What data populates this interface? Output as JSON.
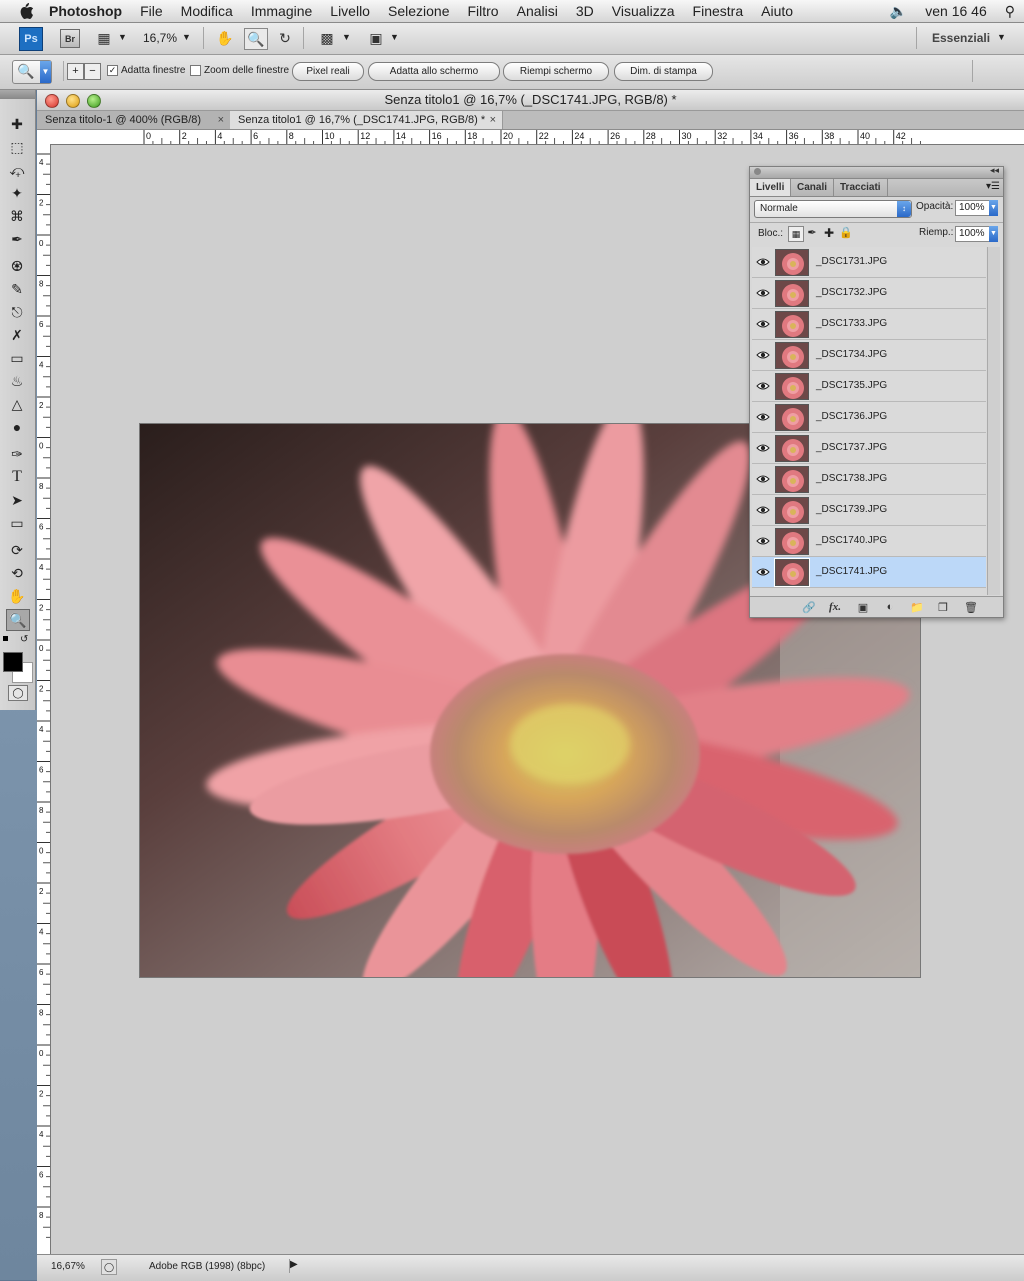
{
  "menubar": {
    "app_name": "Photoshop",
    "items": [
      "File",
      "Modifica",
      "Immagine",
      "Livello",
      "Selezione",
      "Filtro",
      "Analisi",
      "3D",
      "Visualizza",
      "Finestra",
      "Aiuto"
    ],
    "clock": "ven 16 46"
  },
  "appbar": {
    "ps_label": "Ps",
    "br_label": "Br",
    "zoom_value": "16,7%",
    "workspace": "Essenziali"
  },
  "options": {
    "adatta_finestre": "Adatta finestre",
    "adatta_finestre_checked": true,
    "zoom_finestre": "Zoom delle finestre",
    "zoom_finestre_checked": false,
    "btn_pixel_reali": "Pixel reali",
    "btn_adatta_schermo": "Adatta allo schermo",
    "btn_riempi_schermo": "Riempi schermo",
    "btn_dim_stampa": "Dim. di stampa"
  },
  "document": {
    "title": "Senza titolo1 @ 16,7% (_DSC1741.JPG, RGB/8) *",
    "tabs": [
      {
        "label": "Senza titolo-1 @ 400% (RGB/8)",
        "close": "×"
      },
      {
        "label": "Senza titolo1 @ 16,7% (_DSC1741.JPG, RGB/8) *",
        "close": "×"
      }
    ],
    "ruler_h": [
      "0",
      "2",
      "4",
      "6",
      "8",
      "10",
      "12",
      "14",
      "16",
      "18",
      "20",
      "22",
      "24",
      "26",
      "28",
      "30",
      "32",
      "34",
      "36",
      "38",
      "40",
      "42"
    ],
    "ruler_v": [
      "4",
      "2",
      "0",
      "8",
      "6",
      "4",
      "2",
      "0",
      "8",
      "6",
      "4",
      "2",
      "0",
      "2",
      "4",
      "6",
      "8",
      "0",
      "2",
      "4",
      "6",
      "8",
      "0",
      "2",
      "4",
      "6",
      "8"
    ]
  },
  "status": {
    "zoom": "16,67%",
    "profile": "Adobe RGB (1998) (8bpc)"
  },
  "layers_panel": {
    "tabs": [
      "Livelli",
      "Canali",
      "Tracciati"
    ],
    "blend_mode": "Normale",
    "opacity_label": "Opacità:",
    "opacity_value": "100%",
    "lock_label": "Bloc.:",
    "fill_label": "Riemp.:",
    "fill_value": "100%",
    "layers": [
      {
        "name": "_DSC1731.JPG",
        "selected": false
      },
      {
        "name": "_DSC1732.JPG",
        "selected": false
      },
      {
        "name": "_DSC1733.JPG",
        "selected": false
      },
      {
        "name": "_DSC1734.JPG",
        "selected": false
      },
      {
        "name": "_DSC1735.JPG",
        "selected": false
      },
      {
        "name": "_DSC1736.JPG",
        "selected": false
      },
      {
        "name": "_DSC1737.JPG",
        "selected": false
      },
      {
        "name": "_DSC1738.JPG",
        "selected": false
      },
      {
        "name": "_DSC1739.JPG",
        "selected": false
      },
      {
        "name": "_DSC1740.JPG",
        "selected": false
      },
      {
        "name": "_DSC1741.JPG",
        "selected": true
      }
    ],
    "footer_icons": [
      "link-icon",
      "fx-icon",
      "mask-icon",
      "adjustment-icon",
      "folder-icon",
      "new-layer-icon",
      "trash-icon"
    ],
    "fx_label": "fx."
  },
  "colors": {
    "selection": "#bcd8f8",
    "accent": "#2a69c9",
    "canvas_bg": "#cfcfcf"
  }
}
